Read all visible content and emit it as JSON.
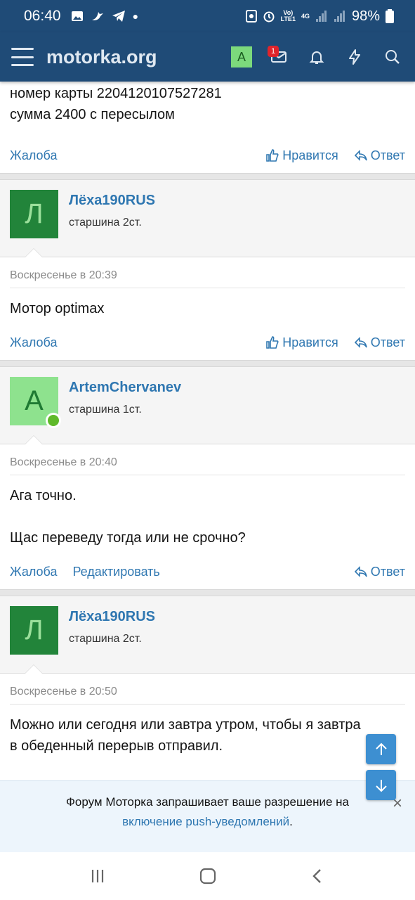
{
  "status_bar": {
    "time": "06:40",
    "net_top": "Vo)",
    "net_bottom": "LTE1",
    "net_gen": "4G",
    "battery": "98%"
  },
  "nav": {
    "site_title": "motorka.org",
    "avatar_letter": "A",
    "messages_badge": "1"
  },
  "posts": [
    {
      "text_lines": [
        "номер карты 2204120107527281",
        "сумма 2400 с пересылом"
      ],
      "actions": {
        "report": "Жалоба",
        "like": "Нравится",
        "reply": "Ответ"
      }
    },
    {
      "author": "Лёха190RUS",
      "avatar_letter": "Л",
      "rank": "старшина 2ст.",
      "date": "Воскресенье в 20:39",
      "text_lines": [
        "Мотор optimax"
      ],
      "actions": {
        "report": "Жалоба",
        "like": "Нравится",
        "reply": "Ответ"
      }
    },
    {
      "author": "ArtemChervanev",
      "avatar_letter": "A",
      "rank": "старшина 1ст.",
      "online": true,
      "date": "Воскресенье в 20:40",
      "text_lines": [
        "Ага точно.",
        "",
        "Щас переведу тогда или не срочно?"
      ],
      "actions": {
        "report": "Жалоба",
        "edit": "Редактировать",
        "reply": "Ответ"
      }
    },
    {
      "author": "Лёха190RUS",
      "avatar_letter": "Л",
      "rank": "старшина 2ст.",
      "date": "Воскресенье в 20:50",
      "text_lines": [
        "Можно или сегодня или завтра утром, чтобы я завтра",
        "в обеденный перерыв отправил."
      ]
    }
  ],
  "push_notice": {
    "text": "Форум Моторка запрашивает ваше разрешение на",
    "link": "включение push-уведомлений",
    "suffix": ".",
    "close": "×"
  },
  "colors": {
    "header": "#1f4b77",
    "link": "#2f77b1",
    "avatar_dark": "#22843a",
    "avatar_light": "#8ee28e",
    "scroll_button": "#3d8fd1"
  }
}
